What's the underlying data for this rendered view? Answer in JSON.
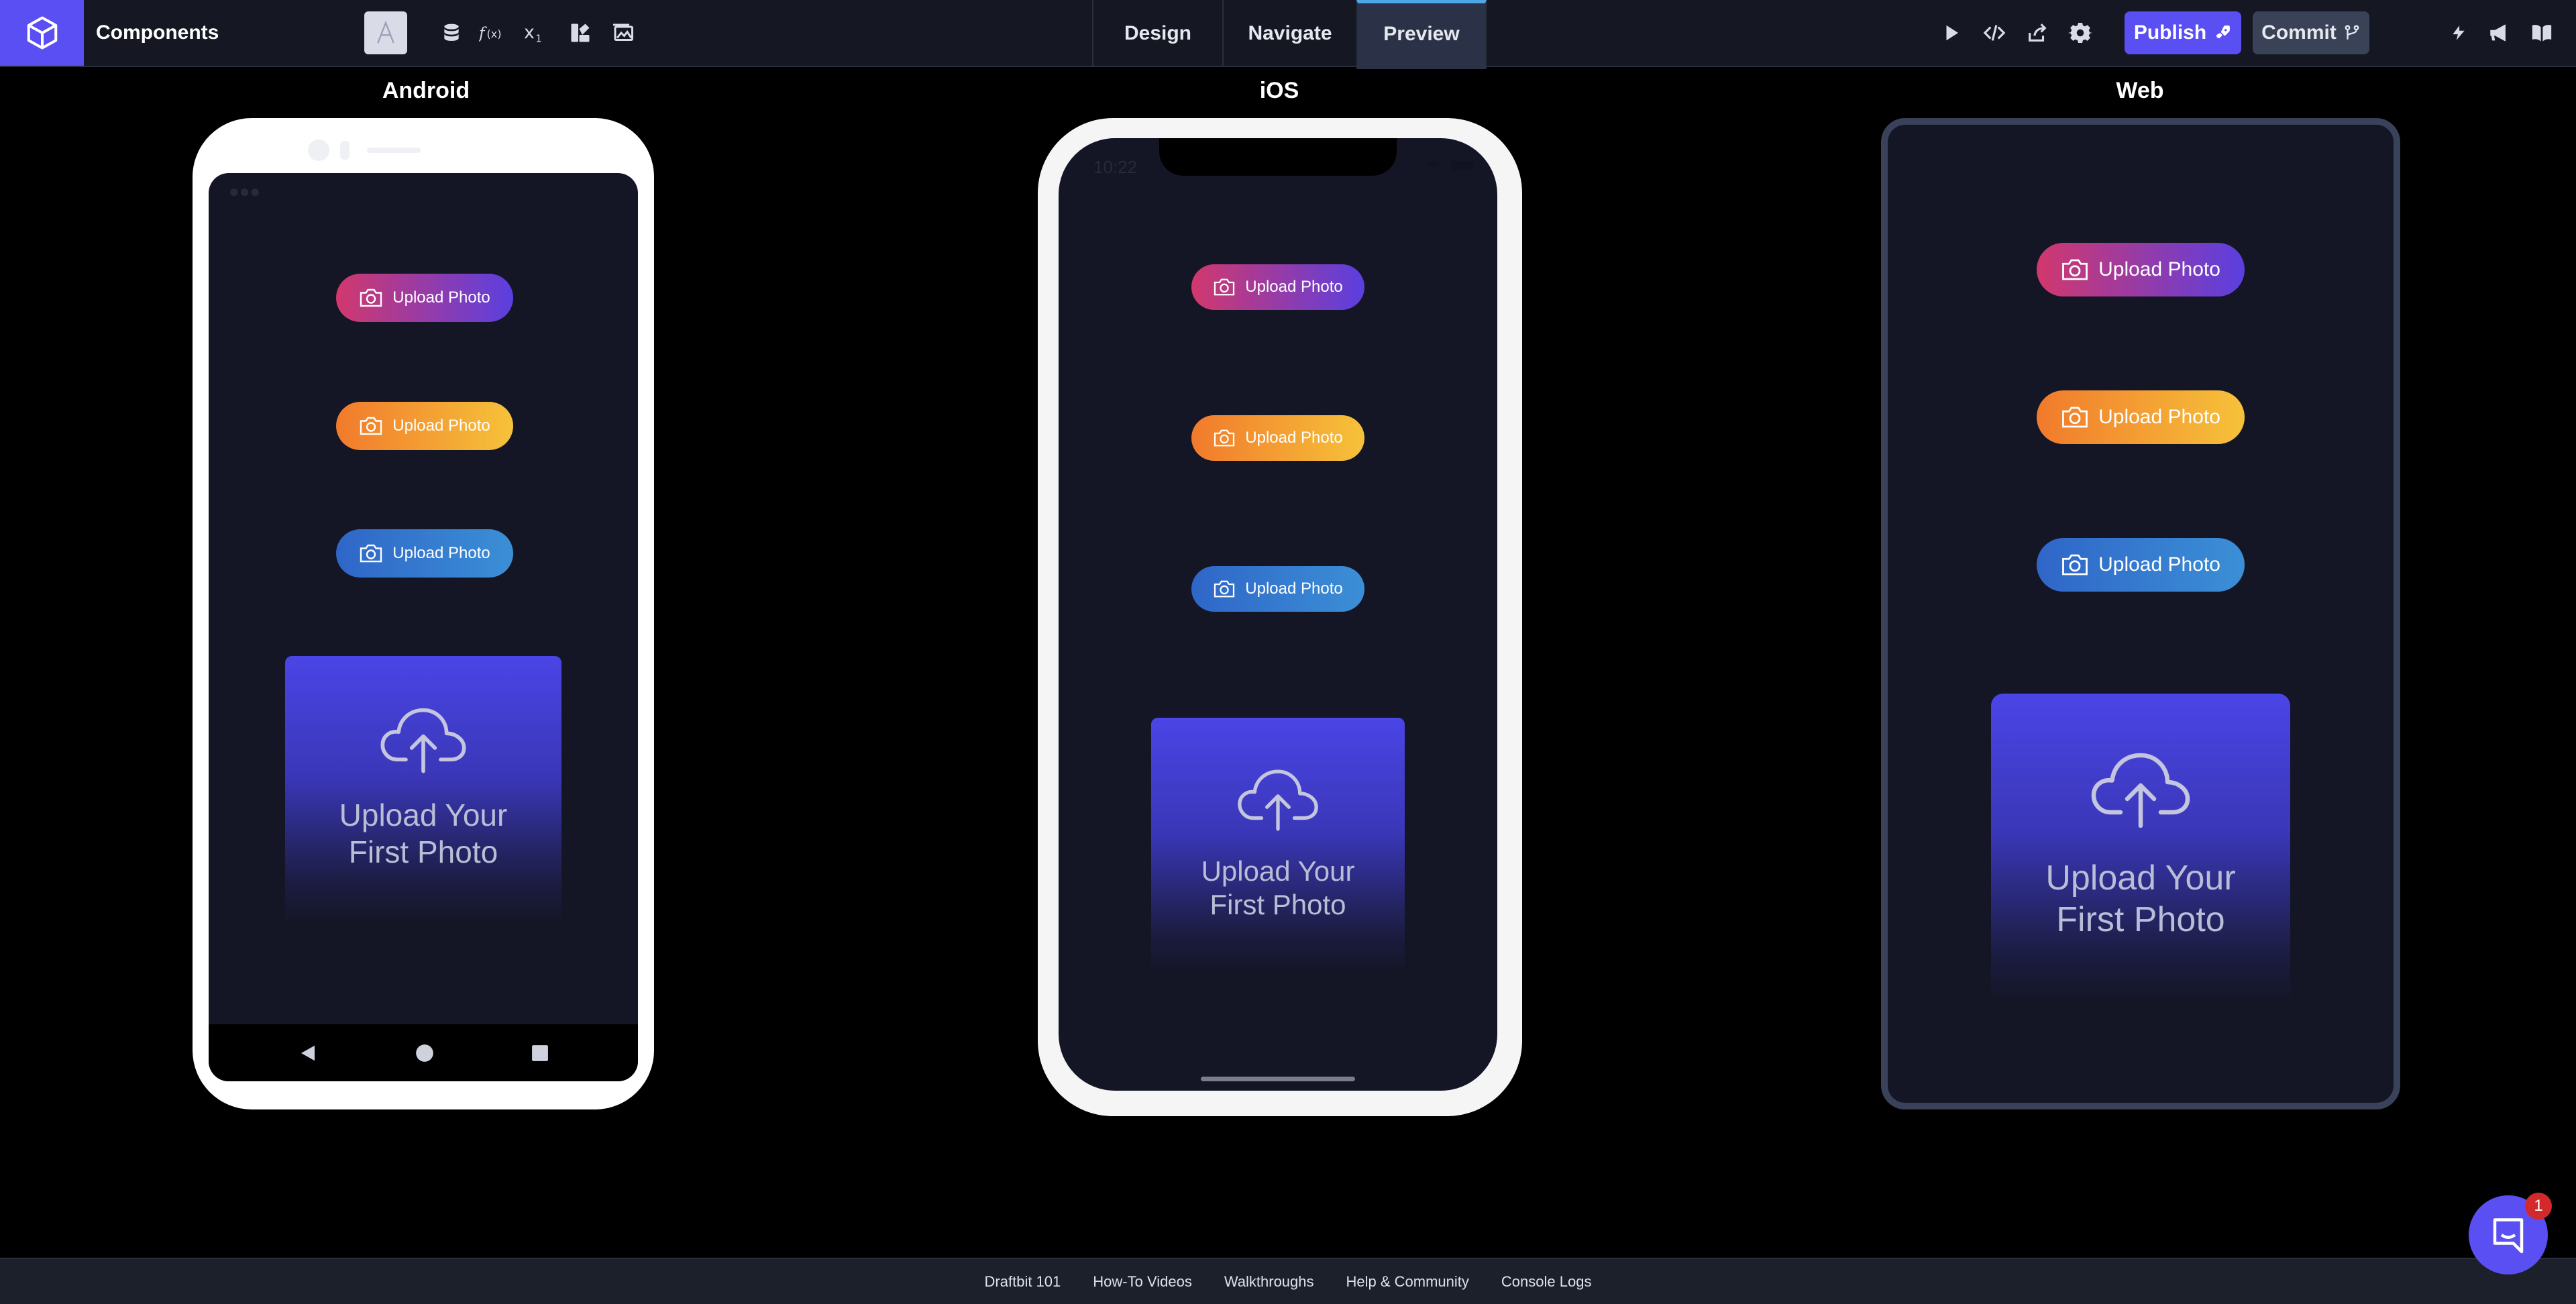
{
  "header": {
    "project_name": "Components",
    "tabs": [
      {
        "label": "Design"
      },
      {
        "label": "Navigate"
      },
      {
        "label": "Preview"
      }
    ],
    "publish_label": "Publish",
    "commit_label": "Commit"
  },
  "platforms": {
    "android": {
      "label": "Android"
    },
    "ios": {
      "label": "iOS",
      "status_time": "10:22"
    },
    "web": {
      "label": "Web"
    }
  },
  "screen": {
    "upload_buttons": [
      {
        "label": "Upload Photo",
        "style": "pink"
      },
      {
        "label": "Upload Photo",
        "style": "orange"
      },
      {
        "label": "Upload Photo",
        "style": "blue"
      }
    ],
    "card_line1": "Upload Your",
    "card_line2": "First Photo"
  },
  "footer": {
    "links": [
      "Draftbit 101",
      "How-To Videos",
      "Walkthroughs",
      "Help & Community",
      "Console Logs"
    ]
  },
  "chat": {
    "badge_count": "1"
  },
  "colors": {
    "accent": "#5a4ff3",
    "topbar_bg": "#151822",
    "screen_bg": "#141626",
    "preview_tab_active": "#2b3248"
  },
  "icons": [
    "logo-icon",
    "database-icon",
    "function-icon",
    "variable-icon",
    "theme-icon",
    "media-icon",
    "play-icon",
    "code-icon",
    "share-icon",
    "gear-icon",
    "rocket-icon",
    "branch-icon",
    "bolt-icon",
    "megaphone-icon",
    "book-icon",
    "camera-icon",
    "cloud-upload-icon",
    "chat-icon"
  ]
}
